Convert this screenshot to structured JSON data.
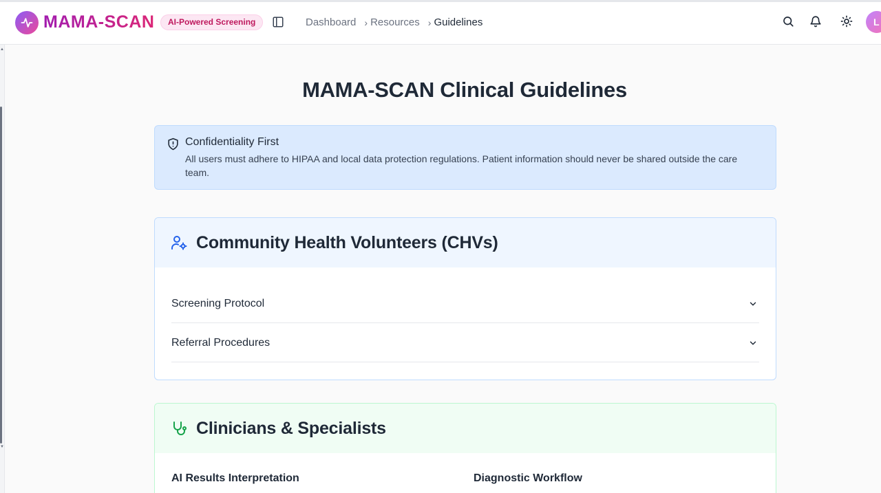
{
  "app": {
    "name": "MAMA-SCAN",
    "badge": "AI-Powered Screening",
    "accent": "#db2777"
  },
  "breadcrumb": [
    {
      "label": "Dashboard"
    },
    {
      "label": "Resources"
    },
    {
      "label": "Guidelines"
    }
  ],
  "header_icons": [
    "search-icon",
    "bell-icon",
    "sun-icon"
  ],
  "user": {
    "initial": "L"
  },
  "page": {
    "title": "MAMA-SCAN Clinical Guidelines"
  },
  "alert": {
    "title": "Confidentiality First",
    "body": "All users must adhere to HIPAA and local data protection regulations. Patient information should never be shared outside the care team.",
    "color": "#dbeafe"
  },
  "sections": {
    "chv": {
      "title": "Community Health Volunteers (CHVs)",
      "items": [
        {
          "label": "Screening Protocol"
        },
        {
          "label": "Referral Procedures"
        }
      ],
      "color": "#eff6ff"
    },
    "clinicians": {
      "title": "Clinicians & Specialists",
      "subsections": [
        {
          "label": "AI Results Interpretation"
        },
        {
          "label": "Diagnostic Workflow"
        }
      ],
      "color": "#f0fdf4"
    }
  }
}
